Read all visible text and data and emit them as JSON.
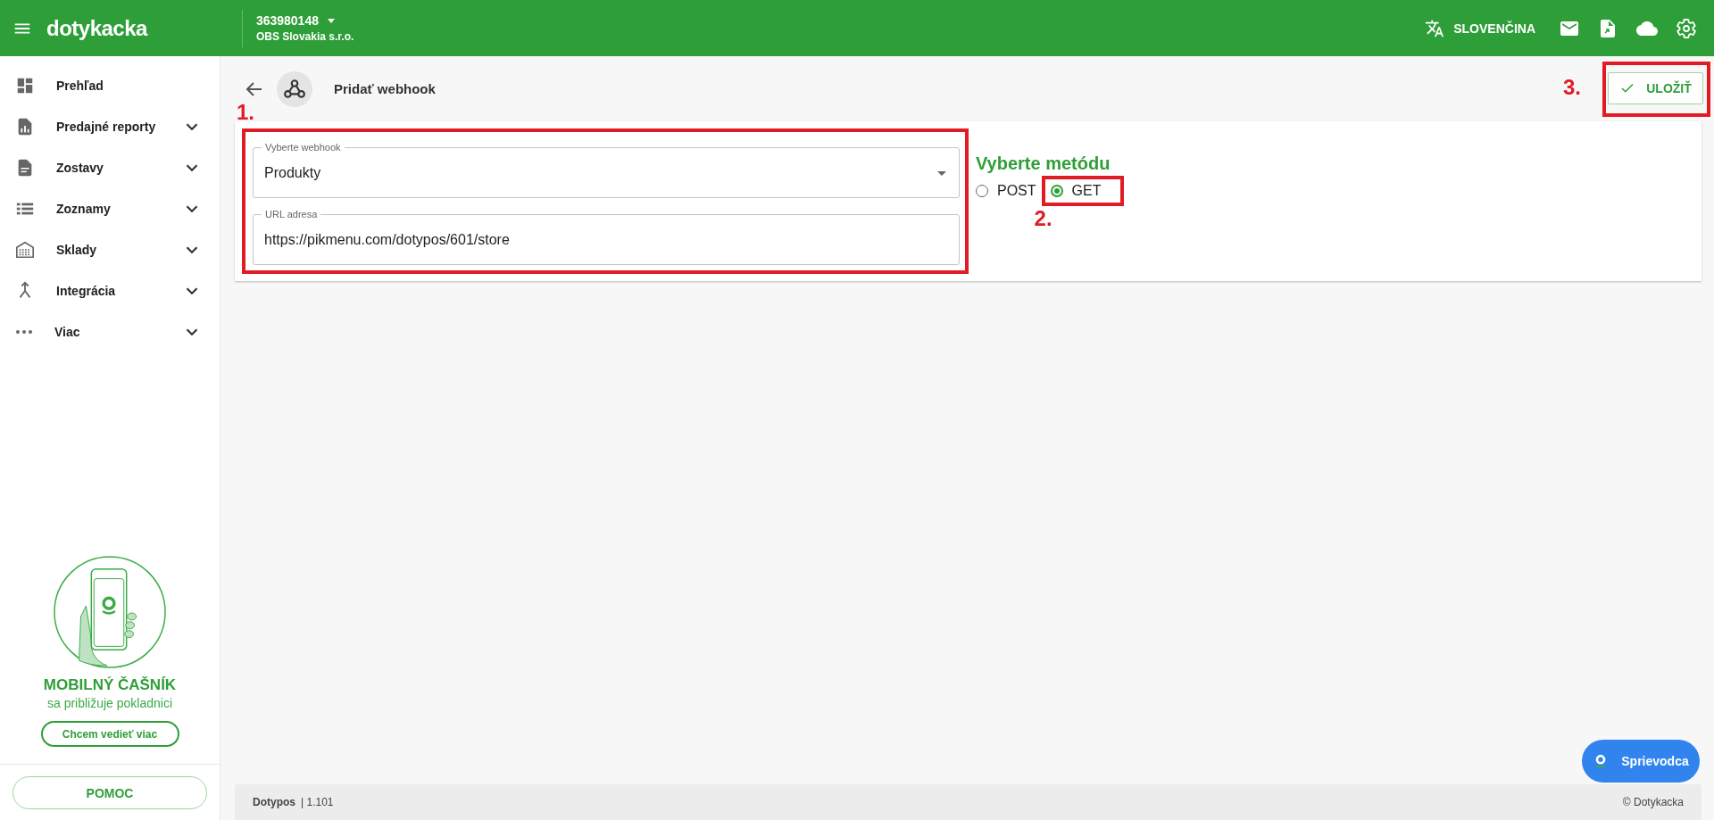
{
  "topbar": {
    "logo": "dotykacka",
    "account_id": "363980148",
    "company": "OBS Slovakia s.r.o.",
    "language": "SLOVENČINA"
  },
  "sidebar": {
    "items": [
      {
        "label": "Prehľad",
        "expandable": false
      },
      {
        "label": "Predajné reporty",
        "expandable": true
      },
      {
        "label": "Zostavy",
        "expandable": true
      },
      {
        "label": "Zoznamy",
        "expandable": true
      },
      {
        "label": "Sklady",
        "expandable": true
      },
      {
        "label": "Integrácia",
        "expandable": true
      },
      {
        "label": "Viac",
        "expandable": true
      }
    ],
    "promo": {
      "title": "MOBILNÝ ČAŠNÍK",
      "subtitle": "sa približuje pokladnici",
      "button": "Chcem vedieť viac"
    },
    "help_button": "POMOC"
  },
  "page": {
    "title": "Pridať webhook",
    "save_button": {
      "label": "ULOŽIŤ",
      "annotation": "3."
    }
  },
  "form": {
    "annotation": "1.",
    "fields": [
      {
        "kind": "select",
        "label": "Vyberte webhook",
        "value": "Produkty"
      },
      {
        "kind": "text",
        "label": "URL adresa",
        "value": "https://pikmenu.com/dotypos/601/store"
      }
    ]
  },
  "method": {
    "title": "Vyberte metódu",
    "annotation": "2.",
    "options": [
      {
        "label": "POST",
        "selected": false
      },
      {
        "label": "GET",
        "selected": true
      }
    ]
  },
  "guide_button": "Sprievodca",
  "footer": {
    "product": "Dotypos",
    "version": "| 1.101",
    "copyright": "© Dotykacka"
  }
}
